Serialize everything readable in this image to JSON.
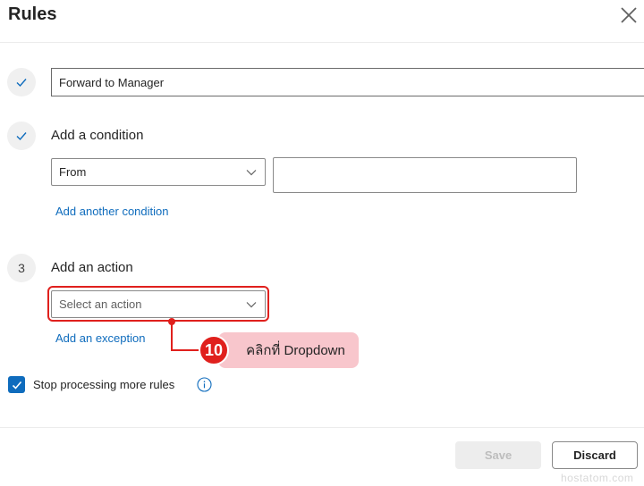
{
  "dialog": {
    "title": "Rules",
    "close_icon": "close-icon"
  },
  "step1": {
    "rule_name_value": "Forward to Manager"
  },
  "step2": {
    "label": "Add a condition",
    "condition_select_value": "From",
    "condition_value_input": "",
    "add_another_link": "Add another condition"
  },
  "step3": {
    "number": "3",
    "label": "Add an action",
    "action_select_placeholder": "Select an action",
    "add_exception_link": "Add an exception"
  },
  "annotation": {
    "badge_number": "10",
    "callout_text": "คลิกที่ Dropdown",
    "color": "#e0201d",
    "callout_bg": "#f8c6cc"
  },
  "options": {
    "stop_processing_label": "Stop processing more rules",
    "stop_processing_checked": true,
    "info_icon": "info-icon"
  },
  "footer": {
    "save_label": "Save",
    "discard_label": "Discard"
  },
  "watermark": "hostatom.com",
  "colors": {
    "accent": "#0f6cbd",
    "highlight": "#e0201d"
  }
}
